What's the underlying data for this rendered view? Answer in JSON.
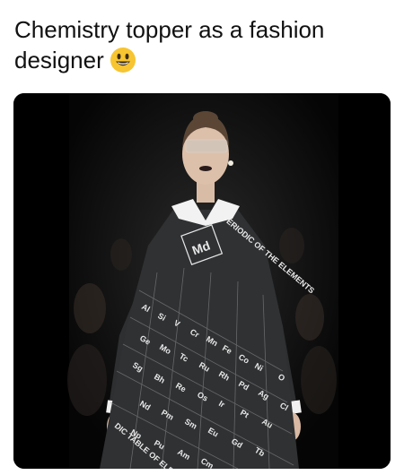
{
  "post": {
    "caption_line1": "Chemistry topper as a fashion",
    "caption_line2": "designer",
    "emoji": "grinning-face-emoji"
  },
  "photo": {
    "description_icon": "runway-model-photo",
    "dress_text_top": "PERIODIC OF THE ELEMENTS",
    "dress_text_bottom": "DIC TABLE OF ELEMENTS",
    "featured_element": "Md",
    "colors": {
      "background": "#000000",
      "dress": "#2f3133",
      "element_text": "#e8e8e8",
      "collar": "#f2f2f2"
    }
  }
}
